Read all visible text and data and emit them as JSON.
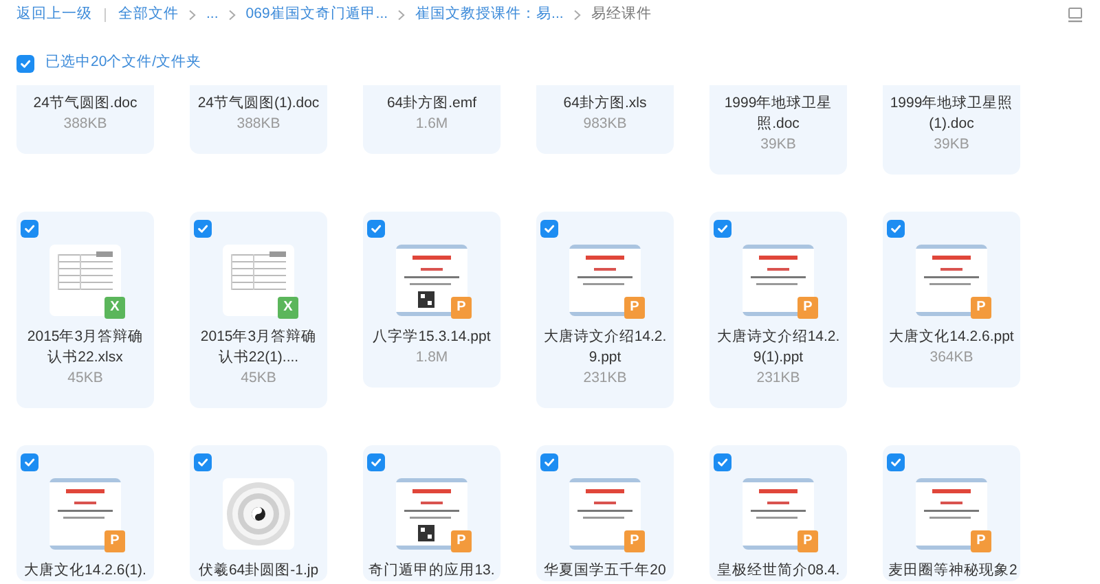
{
  "toolbar": {
    "back": "返回上一级",
    "crumbs": [
      {
        "label": "全部文件",
        "current": false
      },
      {
        "label": "...",
        "current": false
      },
      {
        "label": "069崔国文奇门遁甲...",
        "current": false
      },
      {
        "label": "崔国文教授课件：易...",
        "current": false
      },
      {
        "label": "易经课件",
        "current": true
      }
    ]
  },
  "selection": {
    "checked": true,
    "label": "已选中20个文件/文件夹"
  },
  "rows": [
    {
      "files": [
        {
          "name": "24节气圆图.doc",
          "size": "388KB"
        },
        {
          "name": "24节气圆图(1).doc",
          "size": "388KB"
        },
        {
          "name": "64卦方图.emf",
          "size": "1.6M"
        },
        {
          "name": "64卦方图.xls",
          "size": "983KB"
        },
        {
          "name": "1999年地球卫星照.doc",
          "size": "39KB"
        },
        {
          "name": "1999年地球卫星照(1).doc",
          "size": "39KB"
        }
      ]
    },
    {
      "files": [
        {
          "checked": true,
          "badge": {
            "kind": "excel",
            "letter": "X"
          },
          "name": "2015年3月答辩确认书22.xlsx",
          "size": "45KB"
        },
        {
          "checked": true,
          "badge": {
            "kind": "excel",
            "letter": "X"
          },
          "name": "2015年3月答辩确认书22(1)....",
          "size": "45KB"
        },
        {
          "checked": true,
          "badge": {
            "kind": "ppt",
            "letter": "P"
          },
          "name": "八字学15.3.14.ppt",
          "size": "1.8M"
        },
        {
          "checked": true,
          "badge": {
            "kind": "ppt",
            "letter": "P"
          },
          "name": "大唐诗文介绍14.2.9.ppt",
          "size": "231KB"
        },
        {
          "checked": true,
          "badge": {
            "kind": "ppt",
            "letter": "P"
          },
          "name": "大唐诗文介绍14.2.9(1).ppt",
          "size": "231KB"
        },
        {
          "checked": true,
          "badge": {
            "kind": "ppt",
            "letter": "P"
          },
          "name": "大唐文化14.2.6.ppt",
          "size": "364KB"
        }
      ]
    },
    {
      "files": [
        {
          "checked": true,
          "badge": {
            "kind": "ppt",
            "letter": "P"
          },
          "name": "大唐文化14.2.6(1)."
        },
        {
          "checked": true,
          "name": "伏羲64卦圆图-1.jp"
        },
        {
          "checked": true,
          "badge": {
            "kind": "ppt",
            "letter": "P"
          },
          "name": "奇门遁甲的应用13."
        },
        {
          "checked": true,
          "badge": {
            "kind": "ppt",
            "letter": "P"
          },
          "name": "华夏国学五千年20"
        },
        {
          "checked": true,
          "badge": {
            "kind": "ppt",
            "letter": "P"
          },
          "name": "皇极经世简介08.4."
        },
        {
          "checked": true,
          "badge": {
            "kind": "ppt",
            "letter": "P"
          },
          "name": "麦田圈等神秘现象2"
        }
      ]
    }
  ]
}
